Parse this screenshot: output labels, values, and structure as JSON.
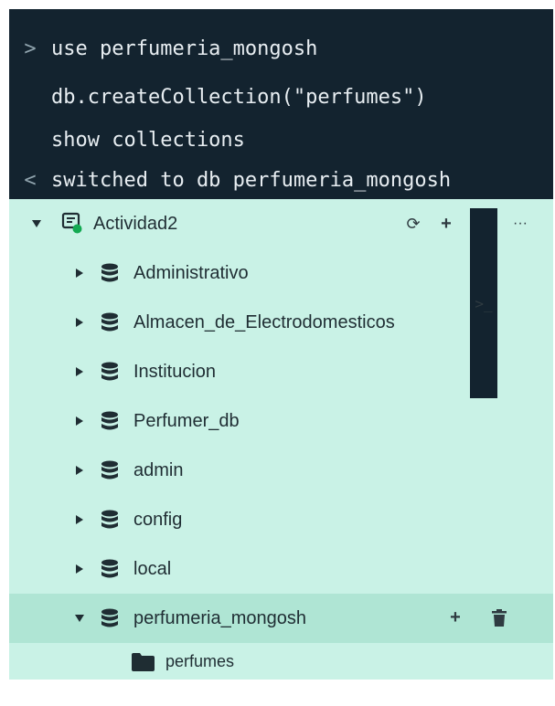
{
  "shell": {
    "lines": [
      {
        "prompt": ">",
        "text": "use perfumeria_mongosh"
      },
      {
        "prompt": "",
        "text": "db.createCollection(\"perfumes\")"
      },
      {
        "prompt": "",
        "text": "show collections"
      },
      {
        "prompt": "<",
        "text": "switched to db perfumeria_mongosh"
      }
    ]
  },
  "tree": {
    "connection": {
      "label": "Actividad2",
      "actions": {
        "refresh": "⟳",
        "add": "+",
        "shell": ">_",
        "more": "···"
      }
    },
    "databases": [
      {
        "name": "Administrativo"
      },
      {
        "name": "Almacen_de_Electrodomesticos"
      },
      {
        "name": "Institucion"
      },
      {
        "name": "Perfumer_db"
      },
      {
        "name": "admin"
      },
      {
        "name": "config"
      },
      {
        "name": "local"
      },
      {
        "name": "perfumeria_mongosh",
        "expanded": true
      }
    ],
    "collections": [
      {
        "name": "perfumes"
      }
    ],
    "selected_actions": {
      "add": "+",
      "delete": "trash-icon"
    }
  },
  "colors": {
    "shell_bg": "#13232f",
    "tree_bg": "#c9f2e6",
    "selected_bg": "#afe5d4",
    "connection_indicator": "#13aa52"
  }
}
